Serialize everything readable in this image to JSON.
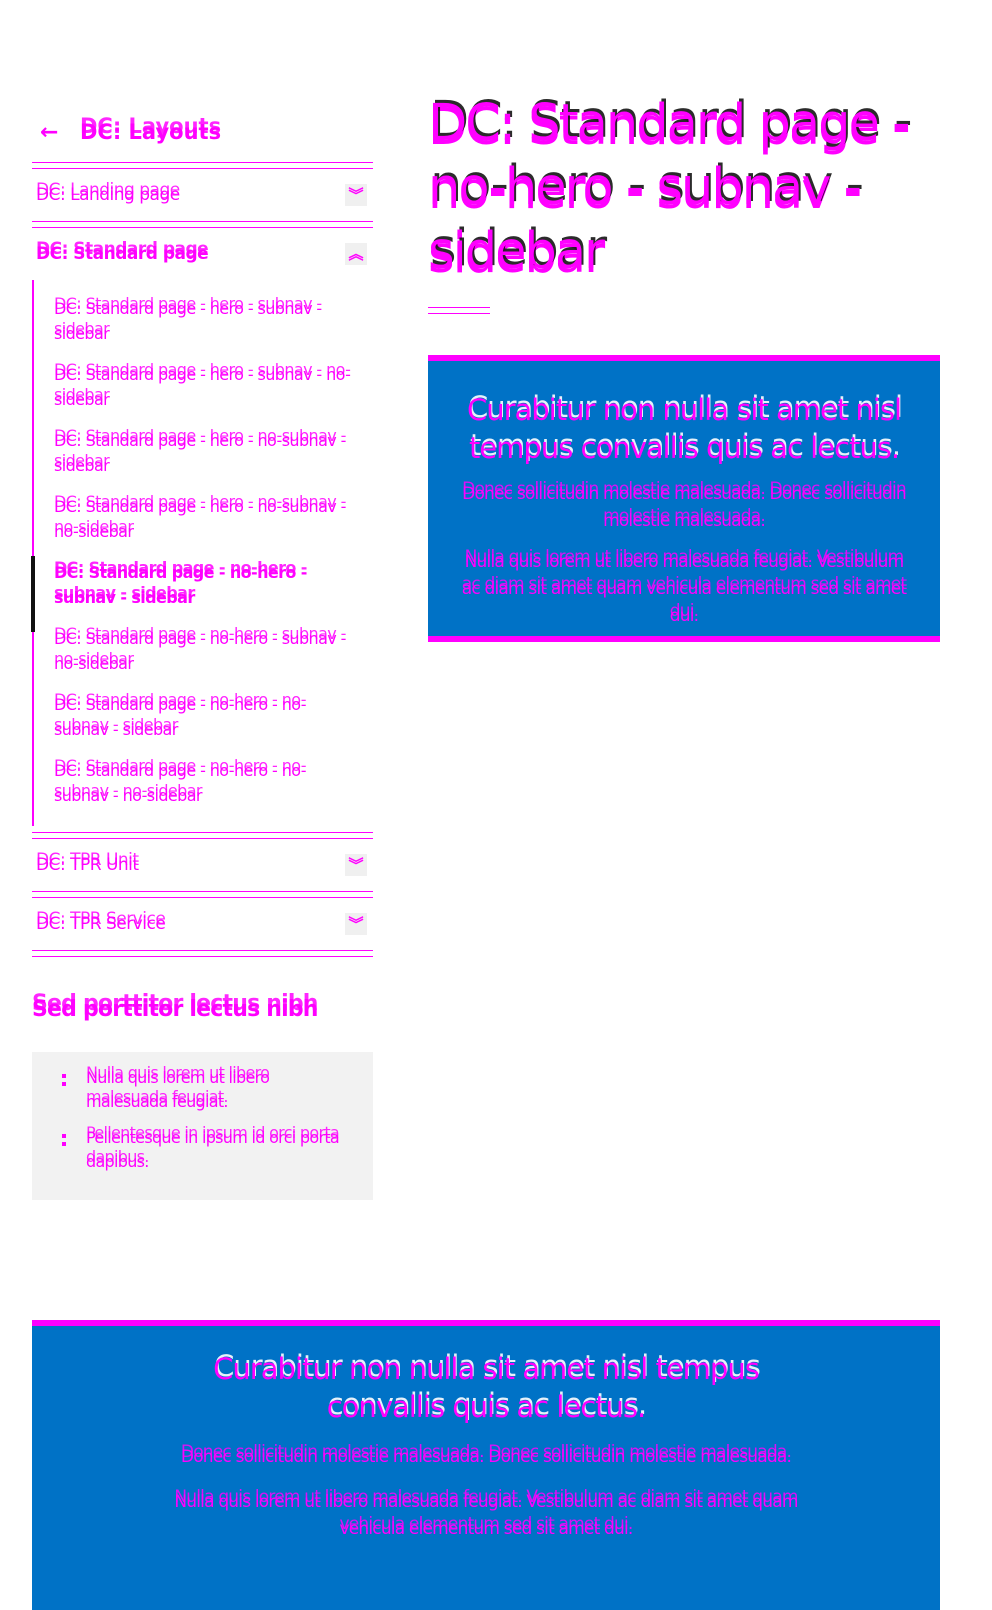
{
  "sidebar": {
    "back_label": "DC: Layouts",
    "sections": [
      {
        "title": "DC: Landing page",
        "expanded": false
      },
      {
        "title": "DC: Standard page",
        "expanded": true
      },
      {
        "title": "DC: TPR Unit",
        "expanded": false
      },
      {
        "title": "DC: TPR Service",
        "expanded": false
      }
    ],
    "subnav": [
      "DC: Standard page - hero - subnav - sidebar",
      "DC: Standard page - hero - subnav - no-sidebar",
      "DC: Standard page - hero - no-subnav - sidebar",
      "DC: Standard page - hero - no-subnav - no-sidebar",
      "DC: Standard page - no-hero - subnav - sidebar",
      "DC: Standard page - no-hero - subnav - no-sidebar",
      "DC: Standard page - no-hero - no-subnav - sidebar",
      "DC: Standard page - no-hero - no-subnav - no-sidebar"
    ],
    "active_subnav_index": 4,
    "box_heading": "Sed porttitor lectus nibh",
    "box_items": [
      "Nulla quis lorem ut libero malesuada feugiat.",
      "Pellentesque in ipsum id orci porta dapibus."
    ]
  },
  "main": {
    "title": "DC: Standard page - no-hero - subnav - sidebar",
    "callout": {
      "heading": "Curabitur non nulla sit amet nisl tempus convallis quis ac lectus.",
      "para1": "Donec sollicitudin molestie malesuada. Donec sollicitudin molestie malesuada.",
      "para2": "Nulla quis lorem ut libero malesuada feugiat. Vestibulum ac diam sit amet quam vehicula elementum sed sit amet dui."
    }
  },
  "footer_callout": {
    "heading": "Curabitur non nulla sit amet nisl tempus convallis quis ac lectus.",
    "para1": "Donec sollicitudin molestie malesuada. Donec sollicitudin molestie malesuada.",
    "para2": "Nulla quis lorem ut libero malesuada feugiat. Vestibulum ac diam sit amet quam vehicula elementum sed sit amet dui."
  },
  "icons": {
    "back": "arrow-left-icon",
    "expand": "chevrons-down-icon",
    "collapse": "chevrons-up-icon"
  },
  "colors": {
    "accent": "#ff00ff",
    "callout_bg": "#0072c6",
    "box_bg": "#f2f2f2"
  }
}
